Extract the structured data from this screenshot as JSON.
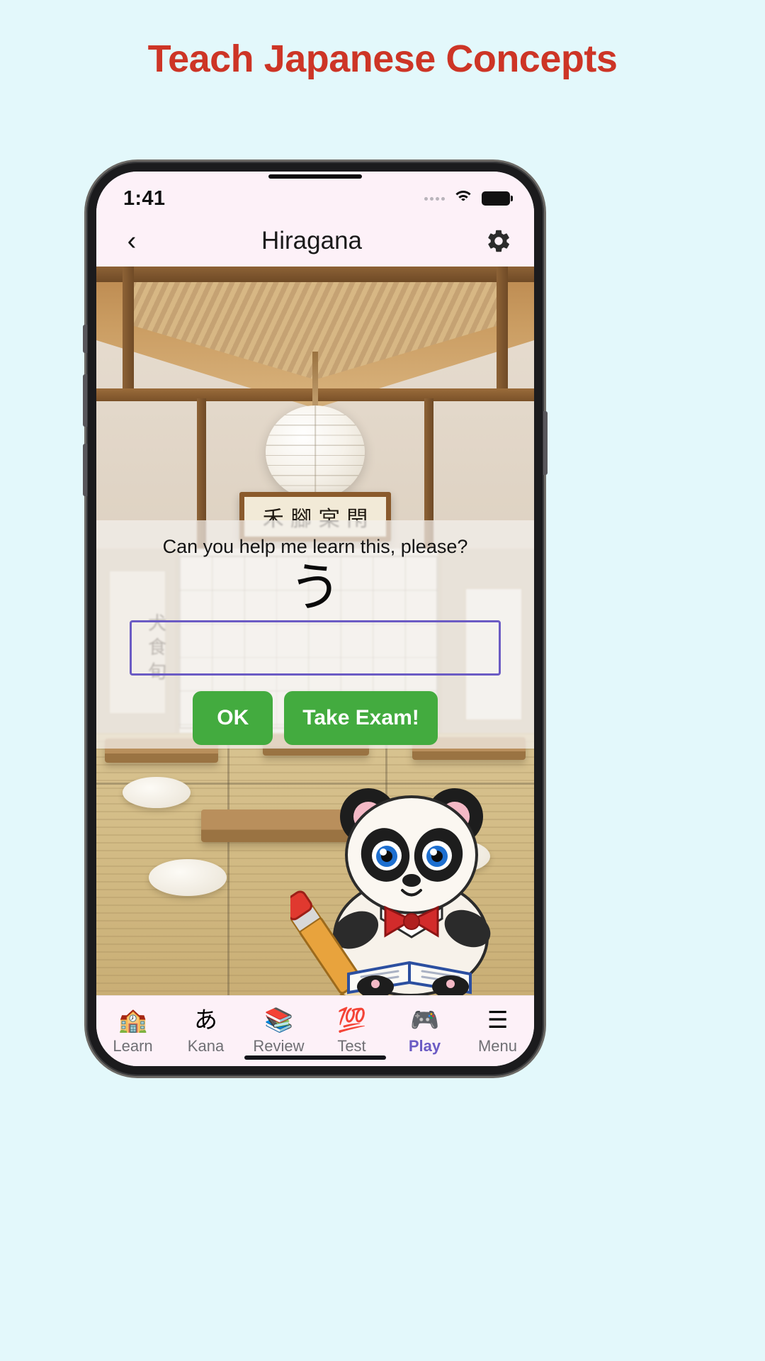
{
  "promo": {
    "headline": "Teach Japanese Concepts",
    "headline_color": "#cd3526",
    "background_color": "#e3f8fb"
  },
  "status_bar": {
    "time": "1:41",
    "signal_icon": "signal-dots-icon",
    "wifi_icon": "wifi-icon",
    "battery_icon": "battery-full-icon"
  },
  "nav_bar": {
    "back_icon": "chevron-left-icon",
    "title": "Hiragana",
    "settings_icon": "gear-icon"
  },
  "scene": {
    "plaque_text": "禾 腳 宲 閇",
    "scroll_text": "犬 食 旬",
    "description": "Japanese traditional classroom with tatami mats, low desks, paper lantern and shoji screens"
  },
  "dialog": {
    "question": "Can you help me learn this, please?",
    "character": "う",
    "input_value": "",
    "input_placeholder": "",
    "buttons": [
      {
        "label": "OK",
        "name": "ok-button",
        "color": "#43ab3f"
      },
      {
        "label": "Take Exam!",
        "name": "take-exam-button",
        "color": "#43ab3f"
      }
    ],
    "input_border_color": "#6b5bc4"
  },
  "mascot": {
    "name": "panda-mascot",
    "description": "Cartoon panda in school uniform with red bow tie holding a pencil and reading an open book"
  },
  "tab_bar": {
    "active_color": "#6b5bc4",
    "inactive_color": "#6f6f74",
    "items": [
      {
        "label": "Learn",
        "icon": "🏫",
        "icon_name": "school-icon",
        "active": false
      },
      {
        "label": "Kana",
        "icon": "あ",
        "icon_name": "kana-a-icon",
        "active": false
      },
      {
        "label": "Review",
        "icon": "📚",
        "icon_name": "books-icon",
        "active": false
      },
      {
        "label": "Test",
        "icon": "💯",
        "icon_name": "hundred-icon",
        "active": false
      },
      {
        "label": "Play",
        "icon": "🎮",
        "icon_name": "gamepad-icon",
        "active": true
      },
      {
        "label": "Menu",
        "icon": "☰",
        "icon_name": "hamburger-icon",
        "active": false
      }
    ]
  }
}
